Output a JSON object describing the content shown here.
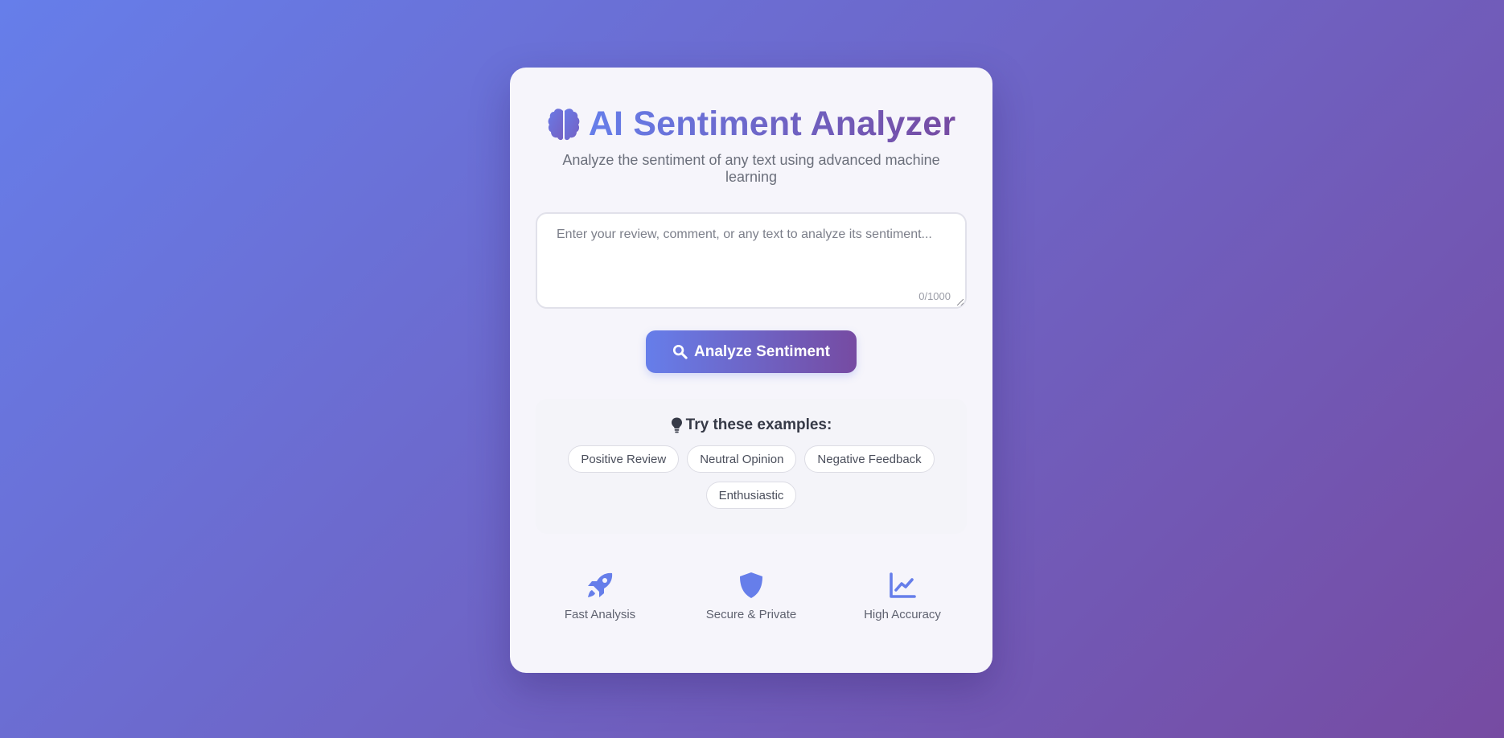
{
  "header": {
    "icon": "brain-icon",
    "title": "AI Sentiment Analyzer",
    "subtitle": "Analyze the sentiment of any text using advanced machine learning"
  },
  "input": {
    "placeholder": "Enter your review, comment, or any text to analyze its sentiment...",
    "value": "",
    "char_count": "0/1000"
  },
  "analyze_button": {
    "icon": "search-icon",
    "label": "Analyze Sentiment"
  },
  "examples": {
    "icon": "lightbulb-icon",
    "title": "Try these examples:",
    "items": [
      {
        "label": "Positive Review"
      },
      {
        "label": "Neutral Opinion"
      },
      {
        "label": "Negative Feedback"
      },
      {
        "label": "Enthusiastic"
      }
    ]
  },
  "features": [
    {
      "icon": "rocket-icon",
      "label": "Fast Analysis"
    },
    {
      "icon": "shield-icon",
      "label": "Secure & Private"
    },
    {
      "icon": "chart-line-icon",
      "label": "High Accuracy"
    }
  ],
  "colors": {
    "gradient_start": "#667eea",
    "gradient_end": "#764ba2",
    "card_background": "#f6f5fb",
    "icon_accent": "#667eea"
  }
}
